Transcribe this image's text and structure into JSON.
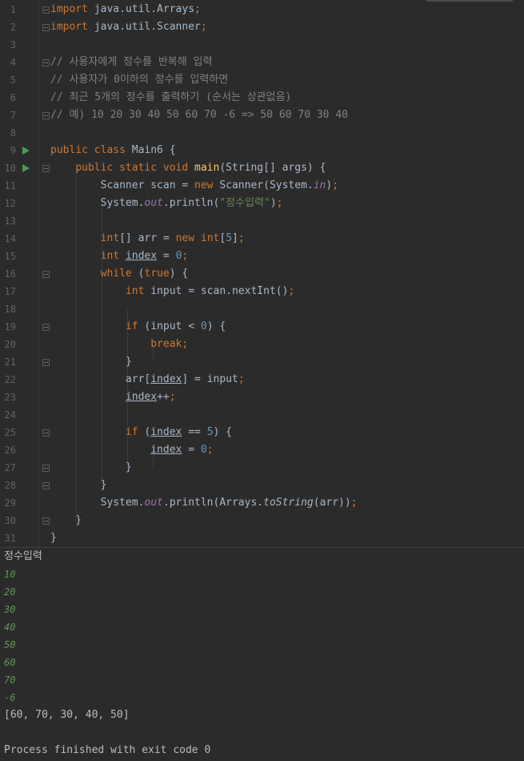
{
  "editor": {
    "lines": [
      {
        "n": "1",
        "tokens": [
          {
            "t": "import",
            "c": "kw"
          },
          {
            "t": " java.util.Arrays"
          },
          {
            "t": ";",
            "c": "kw"
          }
        ]
      },
      {
        "n": "2",
        "tokens": [
          {
            "t": "import",
            "c": "kw"
          },
          {
            "t": " java.util.Scanner"
          },
          {
            "t": ";",
            "c": "kw"
          }
        ]
      },
      {
        "n": "3",
        "tokens": []
      },
      {
        "n": "4",
        "tokens": [
          {
            "t": "// 사용자에게 정수를 반복해 입력",
            "c": "cmt"
          }
        ]
      },
      {
        "n": "5",
        "tokens": [
          {
            "t": "// 사용자가 0이하의 정수를 입력하면",
            "c": "cmt"
          }
        ]
      },
      {
        "n": "6",
        "tokens": [
          {
            "t": "// 최근 5개의 정수를 출력하기 (순서는 상관없음)",
            "c": "cmt"
          }
        ]
      },
      {
        "n": "7",
        "tokens": [
          {
            "t": "// 예) 10 20 30 40 50 60 70 -6 => 50 60 70 30 40",
            "c": "cmt"
          }
        ]
      },
      {
        "n": "8",
        "tokens": []
      },
      {
        "n": "9",
        "tokens": [
          {
            "t": "public class ",
            "c": "kw"
          },
          {
            "t": "Main6 {"
          }
        ]
      },
      {
        "n": "10",
        "tokens": [
          {
            "t": "    "
          },
          {
            "t": "public static void ",
            "c": "kw"
          },
          {
            "t": "main",
            "c": "fn"
          },
          {
            "t": "(String[] args) {"
          }
        ]
      },
      {
        "n": "11",
        "tokens": [
          {
            "t": "        Scanner scan = "
          },
          {
            "t": "new ",
            "c": "kw"
          },
          {
            "t": "Scanner(System."
          },
          {
            "t": "in",
            "c": "fld"
          },
          {
            "t": ")"
          },
          {
            "t": ";",
            "c": "kw"
          }
        ]
      },
      {
        "n": "12",
        "tokens": [
          {
            "t": "        System."
          },
          {
            "t": "out",
            "c": "fld"
          },
          {
            "t": ".println("
          },
          {
            "t": "\"정수입력\"",
            "c": "str"
          },
          {
            "t": ")"
          },
          {
            "t": ";",
            "c": "kw"
          }
        ]
      },
      {
        "n": "13",
        "tokens": []
      },
      {
        "n": "14",
        "tokens": [
          {
            "t": "        "
          },
          {
            "t": "int",
            "c": "kw"
          },
          {
            "t": "[] arr = "
          },
          {
            "t": "new int",
            "c": "kw"
          },
          {
            "t": "["
          },
          {
            "t": "5",
            "c": "num"
          },
          {
            "t": "]"
          },
          {
            "t": ";",
            "c": "kw"
          }
        ]
      },
      {
        "n": "15",
        "tokens": [
          {
            "t": "        "
          },
          {
            "t": "int ",
            "c": "kw"
          },
          {
            "t": "index",
            "c": "ul"
          },
          {
            "t": " = "
          },
          {
            "t": "0",
            "c": "num"
          },
          {
            "t": ";",
            "c": "kw"
          }
        ]
      },
      {
        "n": "16",
        "tokens": [
          {
            "t": "        "
          },
          {
            "t": "while ",
            "c": "kw"
          },
          {
            "t": "("
          },
          {
            "t": "true",
            "c": "kw"
          },
          {
            "t": ") {"
          }
        ]
      },
      {
        "n": "17",
        "tokens": [
          {
            "t": "            "
          },
          {
            "t": "int ",
            "c": "kw"
          },
          {
            "t": "input = scan.nextInt()"
          },
          {
            "t": ";",
            "c": "kw"
          }
        ]
      },
      {
        "n": "18",
        "tokens": []
      },
      {
        "n": "19",
        "tokens": [
          {
            "t": "            "
          },
          {
            "t": "if ",
            "c": "kw"
          },
          {
            "t": "(input < "
          },
          {
            "t": "0",
            "c": "num"
          },
          {
            "t": ") {"
          }
        ]
      },
      {
        "n": "20",
        "tokens": [
          {
            "t": "                "
          },
          {
            "t": "break;",
            "c": "kw"
          }
        ]
      },
      {
        "n": "21",
        "tokens": [
          {
            "t": "            }"
          }
        ]
      },
      {
        "n": "22",
        "tokens": [
          {
            "t": "            arr["
          },
          {
            "t": "index",
            "c": "ul"
          },
          {
            "t": "] = input"
          },
          {
            "t": ";",
            "c": "kw"
          }
        ]
      },
      {
        "n": "23",
        "tokens": [
          {
            "t": "            "
          },
          {
            "t": "index",
            "c": "ul"
          },
          {
            "t": "++"
          },
          {
            "t": ";",
            "c": "kw"
          }
        ]
      },
      {
        "n": "24",
        "tokens": []
      },
      {
        "n": "25",
        "tokens": [
          {
            "t": "            "
          },
          {
            "t": "if ",
            "c": "kw"
          },
          {
            "t": "("
          },
          {
            "t": "index",
            "c": "ul"
          },
          {
            "t": " == "
          },
          {
            "t": "5",
            "c": "num"
          },
          {
            "t": ") {"
          }
        ]
      },
      {
        "n": "26",
        "tokens": [
          {
            "t": "                "
          },
          {
            "t": "index",
            "c": "ul"
          },
          {
            "t": " = "
          },
          {
            "t": "0",
            "c": "num"
          },
          {
            "t": ";",
            "c": "kw"
          }
        ]
      },
      {
        "n": "27",
        "tokens": [
          {
            "t": "            }"
          }
        ]
      },
      {
        "n": "28",
        "tokens": [
          {
            "t": "        }"
          }
        ]
      },
      {
        "n": "29",
        "tokens": [
          {
            "t": "        System."
          },
          {
            "t": "out",
            "c": "fld"
          },
          {
            "t": ".println(Arrays."
          },
          {
            "t": "toString",
            "c": "stat"
          },
          {
            "t": "(arr))"
          },
          {
            "t": ";",
            "c": "kw"
          }
        ]
      },
      {
        "n": "30",
        "tokens": [
          {
            "t": "    }"
          }
        ]
      },
      {
        "n": "31",
        "tokens": [
          {
            "t": "}"
          }
        ]
      }
    ],
    "run_lines": [
      "9",
      "10"
    ],
    "fold_lines": [
      "1",
      "2",
      "4",
      "7",
      "10",
      "16",
      "19",
      "21",
      "25",
      "27",
      "28",
      "30"
    ]
  },
  "console": {
    "prompt": "정수입력",
    "inputs": [
      "10",
      "20",
      "30",
      "40",
      "50",
      "60",
      "70",
      "-6"
    ],
    "output": "[60, 70, 30, 40, 50]",
    "exit_message": "Process finished with exit code 0"
  }
}
